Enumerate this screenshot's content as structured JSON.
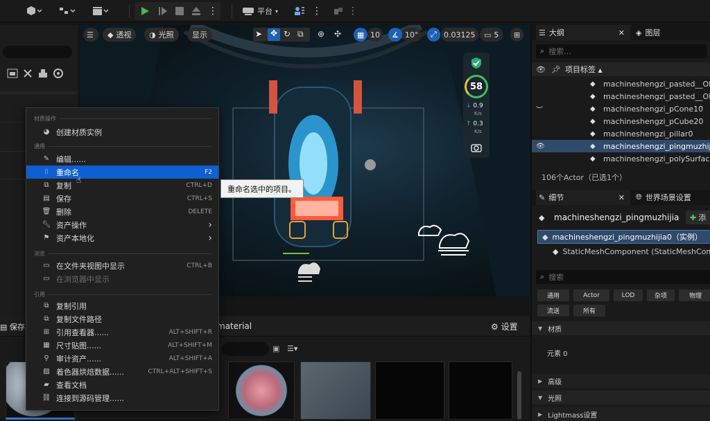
{
  "toolbar": {
    "platform_label": "平台",
    "icons": [
      "add-actor-icon",
      "blueprint-icon",
      "cinematics-icon",
      "play-icon",
      "step-icon",
      "stop-icon",
      "eject-icon",
      "more-icon",
      "platform-icon",
      "settings-icon"
    ]
  },
  "viewport": {
    "perspective_label": "透视",
    "lit_label": "光照",
    "show_label": "显示",
    "grid_value": "10",
    "angle_value": "10°",
    "scale_value": "0.03125",
    "camera_speed": "5",
    "fps": "58",
    "net_down": "0.9",
    "net_up": "0.3",
    "net_unit": "K/s"
  },
  "context_menu": {
    "section_material": "材质操作",
    "create_material_instance": "创建材质实例",
    "section_common": "通用",
    "items_common": [
      {
        "label": "编辑......",
        "shortcut": ""
      },
      {
        "label": "重命名",
        "shortcut": "F2"
      },
      {
        "label": "复制",
        "shortcut": "CTRL+D"
      },
      {
        "label": "保存",
        "shortcut": "CTRL+S"
      },
      {
        "label": "删除",
        "shortcut": "DELETE"
      },
      {
        "label": "资产操作",
        "shortcut": ""
      },
      {
        "label": "资产本地化",
        "shortcut": ""
      }
    ],
    "section_browse": "浏览",
    "items_browse": [
      {
        "label": "在文件夹视图中显示",
        "shortcut": "CTRL+B"
      },
      {
        "label": "在浏览器中显示",
        "shortcut": ""
      }
    ],
    "section_reference": "引用",
    "items_reference": [
      {
        "label": "复制引用",
        "shortcut": ""
      },
      {
        "label": "复制文件路径",
        "shortcut": ""
      },
      {
        "label": "引用查看器......",
        "shortcut": "ALT+SHIFT+R"
      },
      {
        "label": "尺寸贴图......",
        "shortcut": "ALT+SHIFT+M"
      },
      {
        "label": "审计资产......",
        "shortcut": "ALT+SHIFT+A"
      },
      {
        "label": "着色器烘焙数据......",
        "shortcut": "CTRL+ALT+SHIFT+S"
      },
      {
        "label": "查看文档",
        "shortcut": ""
      },
      {
        "label": "连接到源码管理......",
        "shortcut": ""
      }
    ]
  },
  "tooltip": "重命名选中的项目。",
  "bottom_panel": {
    "save_label": "保存",
    "path_label": "material",
    "settings_label": "设置"
  },
  "outliner": {
    "tab_label": "大纲",
    "layers_label": "图层",
    "search_placeholder": "搜索...",
    "column_label": "项目标签",
    "rows": [
      "machineshengzi_pasted__Obj",
      "machineshengzi_pasted__Obj",
      "machineshengzi_pCone10",
      "machineshengzi_pCube20",
      "machineshengzi_pillar0",
      "machineshengzi_pingmuzhijia",
      "machineshengzi_polySurface"
    ],
    "selected_index": 5,
    "count_label": "106个Actor（已选1个）"
  },
  "details": {
    "tab_label": "细节",
    "world_settings_label": "世界场景设置",
    "actor_name": "machineshengzi_pingmuzhijia",
    "add_label": "添",
    "instance_label": "machineshengzi_pingmuzhijia0（实例）",
    "component_label": "StaticMeshComponent (StaticMeshCom",
    "search_placeholder": "搜索",
    "filters_row1": [
      "通用",
      "Actor",
      "LOD",
      "杂项",
      "物理"
    ],
    "filters_row2": [
      "流送",
      "所有"
    ],
    "section_materials": "材质",
    "element_label": "元素 0",
    "section_advanced": "高级",
    "section_lighting": "光照",
    "section_lightmass": "Lightmass设置"
  }
}
